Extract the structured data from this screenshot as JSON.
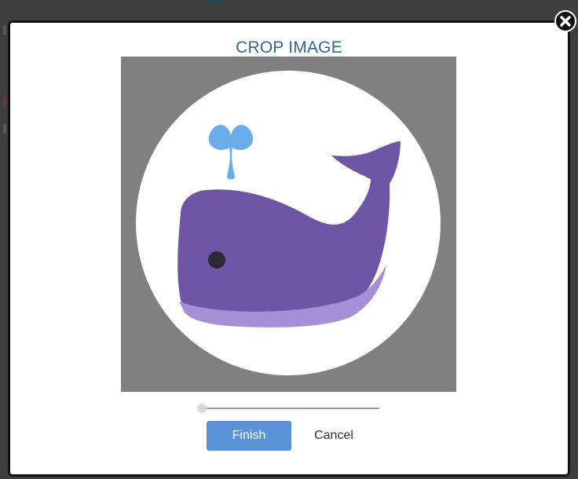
{
  "modal": {
    "title": "CROP IMAGE"
  },
  "crop": {
    "image_icon": "whale-emoji-icon",
    "mask_shape": "circle",
    "zoom_level": 0
  },
  "actions": {
    "finish_label": "Finish",
    "cancel_label": "Cancel"
  },
  "icons": {
    "close": "close-icon"
  },
  "colors": {
    "title": "#2f6a86",
    "finish_button": "#5b93d9",
    "crop_background": "#808080",
    "whale_body": "#6f55a6",
    "whale_belly": "#a590d6",
    "water_spout": "#6aade8"
  }
}
